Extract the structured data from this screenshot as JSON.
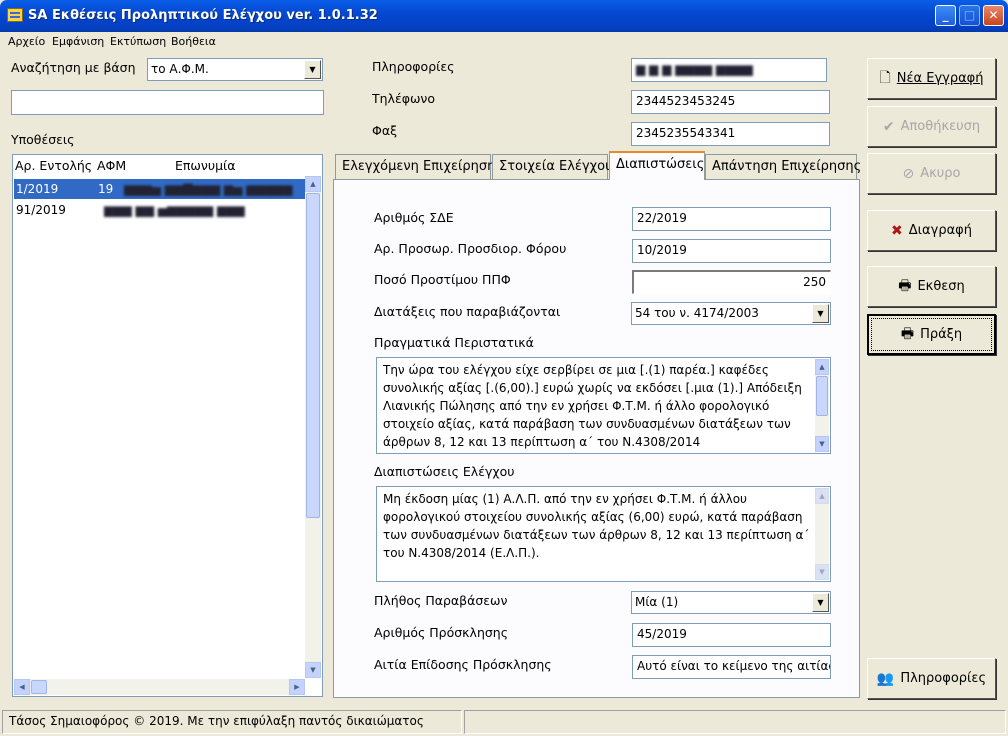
{
  "window": {
    "title": "SA Εκθέσεις Προληπτικού Ελέγχου ver. 1.0.1.32"
  },
  "menu": [
    "Αρχείο",
    "Εμφάνιση",
    "Εκτύπωση",
    "Βοήθεια"
  ],
  "search": {
    "label": "Αναζήτηση με βάση",
    "mode": "το Α.Φ.Μ.",
    "value": ""
  },
  "cases": {
    "label": "Υποθέσεις",
    "columns": [
      "Αρ. Εντολής",
      "ΑΦΜ",
      "Επωνυμία"
    ],
    "rows": [
      {
        "order": "1/2019",
        "afm": "19",
        "name": "",
        "selected": true
      },
      {
        "order": "91/2019",
        "afm": "",
        "name": "",
        "selected": false
      }
    ]
  },
  "info": {
    "info_label": "Πληροφορίες",
    "info_value": "",
    "phone_label": "Τηλέφωνο",
    "phone_value": "2344523453245",
    "fax_label": "Φαξ",
    "fax_value": "2345235543341"
  },
  "tabs": [
    "Ελεγχόμενη Επιχείρηση",
    "Στοιχεία Ελέγχου",
    "Διαπιστώσεις",
    "Απάντηση Επιχείρησης"
  ],
  "active_tab": 2,
  "form": {
    "sde_label": "Αριθμός ΣΔΕ",
    "sde_value": "22/2019",
    "ppf_label": "Αρ. Προσωρ. Προσδιορ. Φόρου",
    "ppf_value": "10/2019",
    "fine_label": "Ποσό Προστίμου ΠΠΦ",
    "fine_value": "250",
    "provisions_label": "Διατάξεις που παραβιάζονται",
    "provisions_value": "54 του ν. 4174/2003",
    "facts_label": "Πραγματικά Περιστατικά",
    "facts_text": "Την ώρα του ελέγχου είχε σερβίρει σε μια  [.(1) παρέα.] καφέδες συνολικής  αξίας  [.(6,00).] ευρώ χωρίς να εκδόσει [.μια (1).] Απόδειξη Λιανικής Πώλησης από την εν χρήσει Φ.Τ.Μ. ή άλλο φορολογικό στοιχείο αξίας, κατά παράβαση των συνδυασμένων διατάξεων των άρθρων 8, 12 και 13 περίπτωση α΄ του Ν.4308/2014",
    "findings_label": "Διαπιστώσεις Ελέγχου",
    "findings_text": "Μη έκδοση μίας (1) Α.Λ.Π. από την εν χρήσει Φ.Τ.Μ. ή άλλου φορολογικού στοιχείου συνολικής αξίας (6,00)  ευρώ, κατά παράβαση των συνδυασμένων διατάξεων των άρθρων 8, 12 και 13 περίπτωση α΄ του Ν.4308/2014 (Ε.Λ.Π.).",
    "violations_label": "Πλήθος Παραβάσεων",
    "violations_value": "Μία (1)",
    "invitation_label": "Αριθμός Πρόσκλησης",
    "invitation_value": "45/2019",
    "reason_label": "Αιτία Επίδοσης Πρόσκλησης",
    "reason_value": "Αυτό είναι το κείμενο της αιτίας"
  },
  "buttons": {
    "new": "Νέα Εγγραφή",
    "save": "Αποθήκευση",
    "cancel": "Ακυρο",
    "delete": "Διαγραφή",
    "report": "Εκθεση",
    "act": "Πράξη",
    "info": "Πληροφορίες"
  },
  "status": {
    "copyright": "Τάσος Σημαιοφόρος © 2019. Με την επιφύλαξη παντός δικαιώματος"
  }
}
